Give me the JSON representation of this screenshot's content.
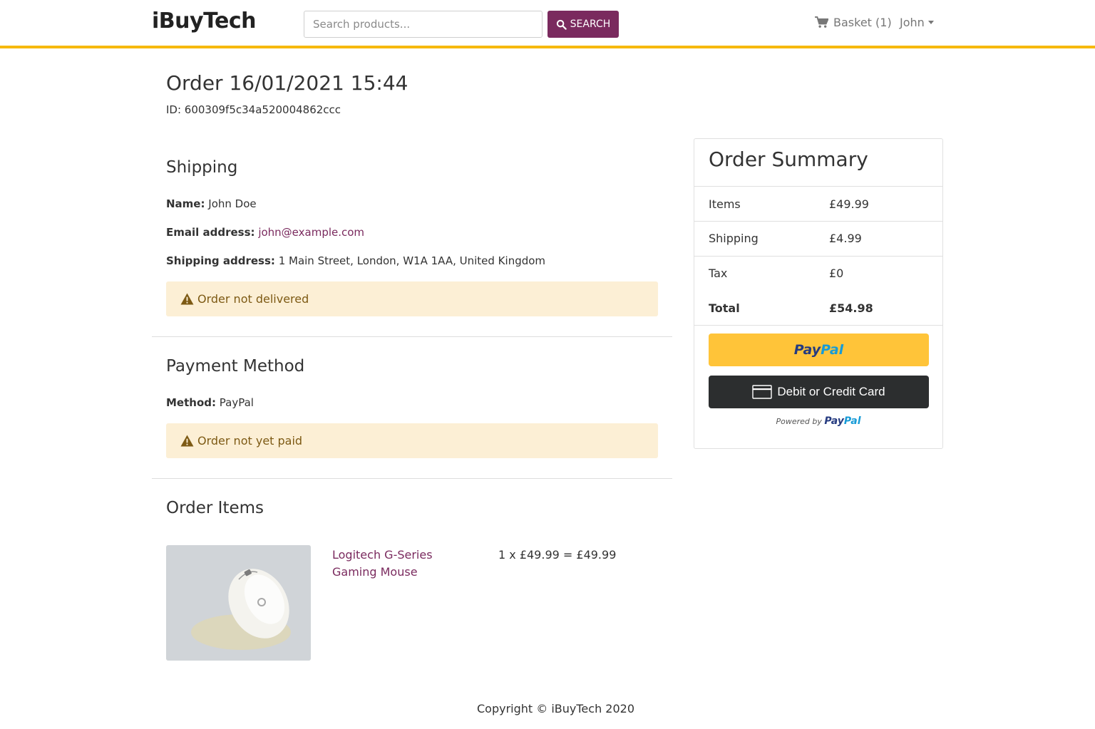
{
  "navbar": {
    "brand": "iBuyTech",
    "search_placeholder": "Search products...",
    "search_button": "SEARCH",
    "basket_label": "Basket (1)",
    "user_name": "John"
  },
  "order": {
    "title": "Order 16/01/2021 15:44",
    "id_line": "ID: 600309f5c34a520004862ccc"
  },
  "shipping": {
    "heading": "Shipping",
    "name_label": "Name:",
    "name_value": "John Doe",
    "email_label": "Email address:",
    "email_value": "john@example.com",
    "address_label": "Shipping address:",
    "address_value": "1 Main Street, London, W1A 1AA, United Kingdom",
    "status": "Order not delivered"
  },
  "payment": {
    "heading": "Payment Method",
    "method_label": "Method:",
    "method_value": "PayPal",
    "status": "Order not yet paid"
  },
  "items": {
    "heading": "Order Items",
    "list": [
      {
        "name": "Logitech G-Series Gaming Mouse",
        "price_line": "1 x £49.99 = £49.99"
      }
    ]
  },
  "summary": {
    "title": "Order Summary",
    "items_label": "Items",
    "items_value": "£49.99",
    "shipping_label": "Shipping",
    "shipping_value": "£4.99",
    "tax_label": "Tax",
    "tax_value": "£0",
    "total_label": "Total",
    "total_value": "£54.98",
    "paypal_button_a": "Pay",
    "paypal_button_b": "Pal",
    "card_button": "Debit or Credit Card",
    "powered_by": "Powered by",
    "powered_a": "Pay",
    "powered_b": "Pal"
  },
  "footer": {
    "copyright": "Copyright © iBuyTech 2020"
  },
  "colors": {
    "accent": "#7a2a5e",
    "navbar_border": "#f6b90e",
    "alert_bg": "#fcefd5",
    "alert_text": "#7d5a14",
    "paypal_yellow": "#ffc439",
    "card_button": "#2c2e2f"
  },
  "icons": {
    "search": "search-icon",
    "basket": "shopping-cart-icon",
    "user_menu": "caret-down-icon",
    "alert": "warning-triangle-icon",
    "card": "credit-card-icon"
  }
}
